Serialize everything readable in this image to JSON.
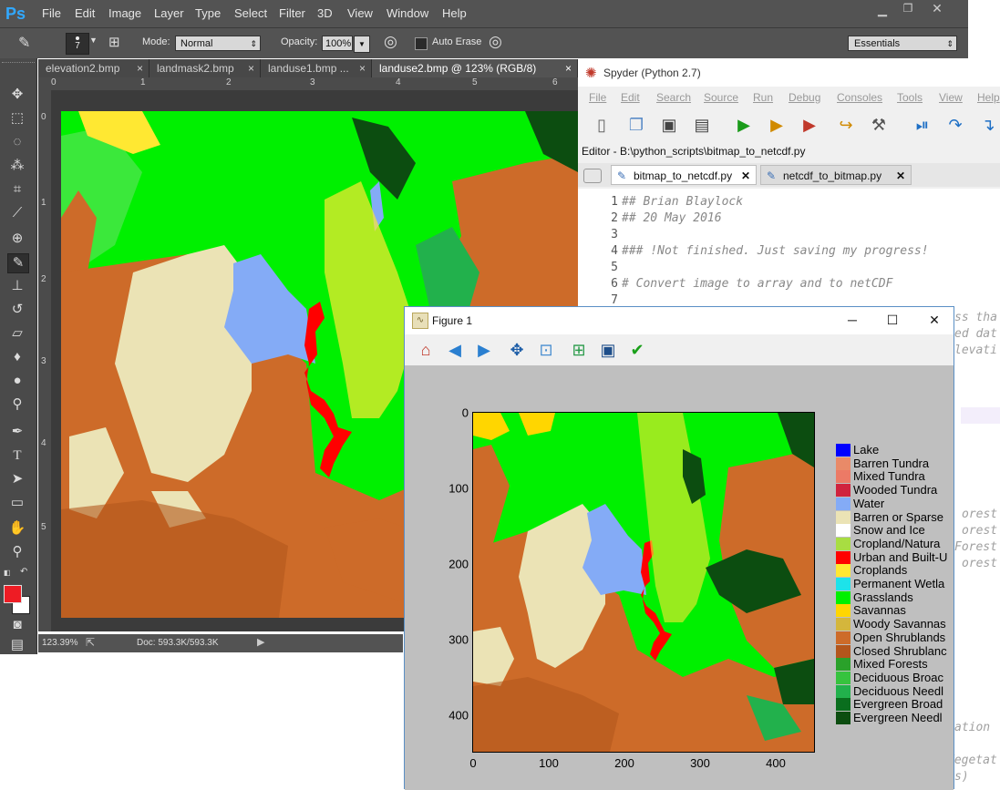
{
  "photoshop": {
    "logo": "Ps",
    "menu": [
      "File",
      "Edit",
      "Image",
      "Layer",
      "Type",
      "Select",
      "Filter",
      "3D",
      "View",
      "Window",
      "Help"
    ],
    "options": {
      "brush_size": "7",
      "mode_label": "Mode:",
      "mode_value": "Normal",
      "opacity_label": "Opacity:",
      "opacity_value": "100%",
      "auto_erase_label": "Auto Erase",
      "workspace": "Essentials"
    },
    "tabs": [
      {
        "label": "elevation2.bmp",
        "close": "×"
      },
      {
        "label": "landmask2.bmp",
        "close": "×"
      },
      {
        "label": "landuse1.bmp ...",
        "close": "×"
      },
      {
        "label": "landuse2.bmp @ 123% (RGB/8)",
        "close": "×"
      }
    ],
    "ruler_top": [
      "0",
      "1",
      "2",
      "3",
      "4",
      "5",
      "6"
    ],
    "ruler_left": [
      "0",
      "1",
      "2",
      "3",
      "4",
      "5"
    ],
    "status": {
      "zoom": "123.39%",
      "doc": "Doc: 593.3K/593.3K"
    }
  },
  "spyder": {
    "title": "Spyder (Python 2.7)",
    "menu": [
      "File",
      "Edit",
      "Search",
      "Source",
      "Run",
      "Debug",
      "Consoles",
      "Tools",
      "View",
      "Help"
    ],
    "editor_label": "Editor - B:\\python_scripts\\bitmap_to_netcdf.py",
    "tabs": [
      "bitmap_to_netcdf.py",
      "netcdf_to_bitmap.py"
    ],
    "code_lines": [
      {
        "n": "1",
        "text": "## Brian Blaylock"
      },
      {
        "n": "2",
        "text": "## 20 May 2016"
      },
      {
        "n": "3",
        "text": ""
      },
      {
        "n": "4",
        "text": "### !Not finished. Just saving my progress!"
      },
      {
        "n": "5",
        "text": ""
      },
      {
        "n": "6",
        "text": "# Convert image to array and to netCDF"
      },
      {
        "n": "7",
        "text": ""
      }
    ],
    "fragments": [
      "ss tha",
      "ed dat",
      "levati",
      "orest",
      "orest",
      "Forest",
      "orest",
      "ation",
      "Vegetat",
      "s)"
    ]
  },
  "figure": {
    "title": "Figure 1",
    "xticks": [
      "0",
      "100",
      "200",
      "300",
      "400"
    ],
    "yticks": [
      "0",
      "100",
      "200",
      "300",
      "400"
    ],
    "legend": [
      {
        "label": "Lake",
        "color": "#0000ff"
      },
      {
        "label": "Barren Tundra",
        "color": "#e98a68"
      },
      {
        "label": "Mixed Tundra",
        "color": "#ec7a66"
      },
      {
        "label": "Wooded Tundra",
        "color": "#d0233e"
      },
      {
        "label": "Water",
        "color": "#84abf6"
      },
      {
        "label": "Barren or Sparse",
        "color": "#ebe3b5"
      },
      {
        "label": "Snow and Ice",
        "color": "#ffffff"
      },
      {
        "label": "Cropland/Natura",
        "color": "#a8dd42"
      },
      {
        "label": "Urban and Built-U",
        "color": "#ff0000"
      },
      {
        "label": "Croplands",
        "color": "#ffe832"
      },
      {
        "label": "Permanent Wetla",
        "color": "#1de3ea"
      },
      {
        "label": "Grasslands",
        "color": "#00f000"
      },
      {
        "label": "Savannas",
        "color": "#ffd600"
      },
      {
        "label": "Woody Savannas",
        "color": "#d4b63c"
      },
      {
        "label": "Open Shrublands",
        "color": "#cd6b29"
      },
      {
        "label": "Closed Shrublanc",
        "color": "#b3561c"
      },
      {
        "label": "Mixed Forests",
        "color": "#2aa12a"
      },
      {
        "label": "Deciduous Broac",
        "color": "#36c33e"
      },
      {
        "label": "Deciduous Needl",
        "color": "#22b14c"
      },
      {
        "label": "Evergreen Broad",
        "color": "#0a6e1e"
      },
      {
        "label": "Evergreen Needl",
        "color": "#0c4d10"
      }
    ]
  }
}
